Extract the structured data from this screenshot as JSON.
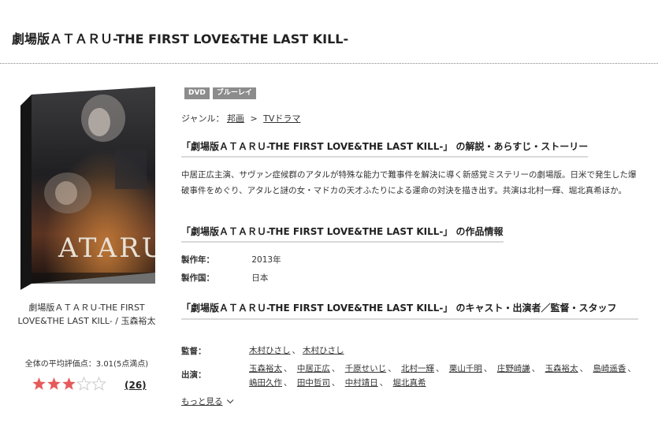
{
  "page": {
    "title": "劇場版ＡＴＡＲＵ-THE FIRST LOVE&THE LAST KILL-"
  },
  "product": {
    "cover_text": "ATARU",
    "name": "劇場版ＡＴＡＲＵ-THE FIRST LOVE&THE LAST KILL- / 玉森裕太",
    "rating_text": "全体の平均評価点：3.01(5点満点)",
    "rating_value": 3.01,
    "rating_max": 5,
    "review_count": "(26)"
  },
  "badges": [
    "DVD",
    "ブルーレイ"
  ],
  "genre": {
    "label": "ジャンル：",
    "items": [
      "邦画",
      "TVドラマ"
    ],
    "separator": ">"
  },
  "sections": {
    "synopsis_heading": "「劇場版ＡＴＡＲＵ-THE FIRST LOVE&THE LAST KILL-」 の解説・あらすじ・ストーリー",
    "synopsis_text": "中居正広主演、サヴァン症候群のアタルが特殊な能力で難事件を解決に導く新感覚ミステリーの劇場版。日米で発生した爆破事件をめぐり、アタルと謎の女・マドカの天才ふたりによる運命の対決を描き出す。共演は北村一輝、堀北真希ほか。",
    "info_heading": "「劇場版ＡＴＡＲＵ-THE FIRST LOVE&THE LAST KILL-」 の作品情報",
    "cast_heading": "「劇場版ＡＴＡＲＵ-THE FIRST LOVE&THE LAST KILL-」 のキャスト・出演者／監督・スタッフ"
  },
  "info": {
    "year_label": "製作年：",
    "year_value": "2013年",
    "country_label": "製作国：",
    "country_value": "日本"
  },
  "credits": {
    "director_label": "監督：",
    "directors": [
      "木村ひさし",
      "木村ひさし"
    ],
    "cast_label": "出演：",
    "cast": [
      "玉森裕太",
      "中居正広",
      "千原せいじ",
      "北村一輝",
      "栗山千明",
      "庄野崎謙",
      "玉森裕太",
      "島崎遥香",
      "嶋田久作",
      "田中哲司",
      "中村靖日",
      "堀北真希"
    ],
    "more_label": "もっと見る"
  },
  "colors": {
    "badge": "#8c8c8c",
    "star_fill": "#e65a5a",
    "star_empty": "#cccccc",
    "rule": "#d9d9d9"
  }
}
